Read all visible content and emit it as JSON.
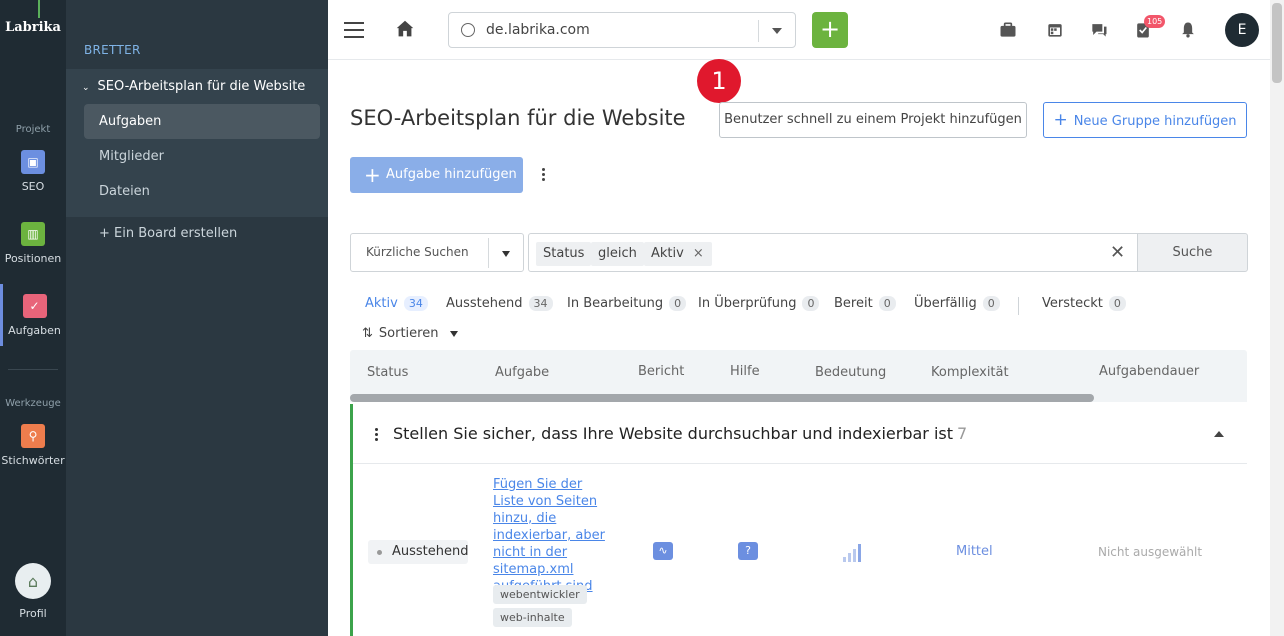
{
  "rail": {
    "logo": "Labrika",
    "section_project": "Projekt",
    "section_tools": "Werkzeuge",
    "items": [
      {
        "label": "SEO",
        "color": "#6c8fe0",
        "icon": "clipboard-icon"
      },
      {
        "label": "Positionen",
        "color": "#6cb33f",
        "icon": "chart-icon"
      },
      {
        "label": "Aufgaben",
        "color": "#e8647a",
        "icon": "check-icon"
      },
      {
        "label": "Stichwörter",
        "color": "#ee7d4d",
        "icon": "key-icon"
      }
    ],
    "profile_label": "Profil"
  },
  "sidebar": {
    "caption": "BRETTER",
    "project_title": "SEO-Arbeitsplan für die Website",
    "sub_items": [
      "Aufgaben",
      "Mitglieder",
      "Dateien"
    ],
    "create_board": "+ Ein Board erstellen"
  },
  "topbar": {
    "url": "de.labrika.com",
    "add_button": "+",
    "notification_badge": "105",
    "user_initial": "E"
  },
  "main": {
    "title": "SEO-Arbeitsplan für die Website",
    "callout_number": "1",
    "quick_add_user": "Benutzer schnell zu einem Projekt hinzufügen",
    "new_group": "Neue Gruppe hinzufügen",
    "add_task": "Aufgabe hinzufügen",
    "recent_searches": "Kürzliche Suchen",
    "filter_chips": [
      "Status",
      "gleich",
      "Aktiv"
    ],
    "search_button": "Suche",
    "tabs": [
      {
        "label": "Aktiv",
        "count": "34"
      },
      {
        "label": "Ausstehend",
        "count": "34"
      },
      {
        "label": "In Bearbeitung",
        "count": "0"
      },
      {
        "label": "In Überprüfung",
        "count": "0"
      },
      {
        "label": "Bereit",
        "count": "0"
      },
      {
        "label": "Überfällig",
        "count": "0"
      },
      {
        "label": "Versteckt",
        "count": "0"
      }
    ],
    "sort_label": "Sortieren",
    "columns": [
      "Status",
      "Aufgabe",
      "Bericht",
      "Hilfe",
      "Bedeutung",
      "Komplexität",
      "Aufgabendauer"
    ],
    "group": {
      "title": "Stellen Sie sicher, dass Ihre Website durchsuchbar und indexierbar ist",
      "count": "7"
    },
    "row": {
      "status": "Ausstehend",
      "task": "Fügen Sie der Liste von Seiten hinzu, die indexierbar, aber nicht in der sitemap.xml aufgeführt sind",
      "tags": [
        "webentwickler",
        "web-inhalte"
      ],
      "help": "?",
      "complexity": "Mittel",
      "duration": "Nicht ausgewählt"
    }
  }
}
